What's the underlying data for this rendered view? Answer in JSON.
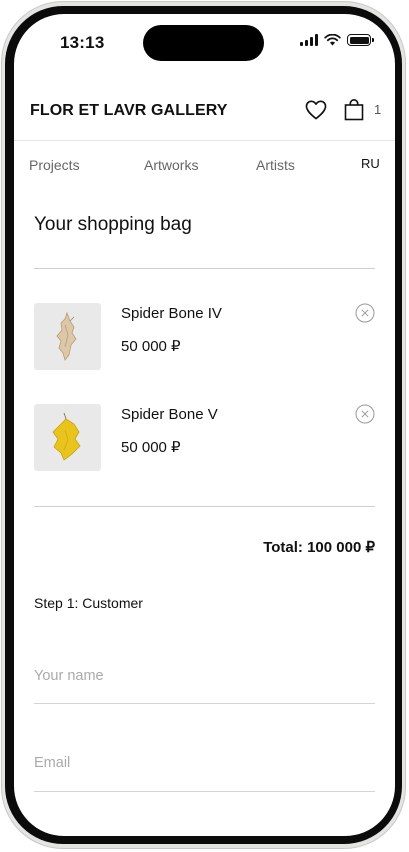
{
  "status_bar": {
    "time": "13:13"
  },
  "header": {
    "brand": "FLOR ET LAVR GALLERY",
    "bag_count": "1"
  },
  "nav": {
    "projects": "Projects",
    "artworks": "Artworks",
    "artists": "Artists",
    "language": "RU"
  },
  "cart": {
    "title": "Your shopping bag",
    "items": [
      {
        "title": "Spider Bone IV",
        "price": "50 000 ₽",
        "thumb_color": "#dcc8a8"
      },
      {
        "title": "Spider Bone V",
        "price": "50 000 ₽",
        "thumb_color": "#e8c41c"
      }
    ],
    "total": "Total: 100 000 ₽"
  },
  "checkout": {
    "step_label": "Step 1: Customer",
    "name_placeholder": "Your name",
    "email_placeholder": "Email"
  }
}
